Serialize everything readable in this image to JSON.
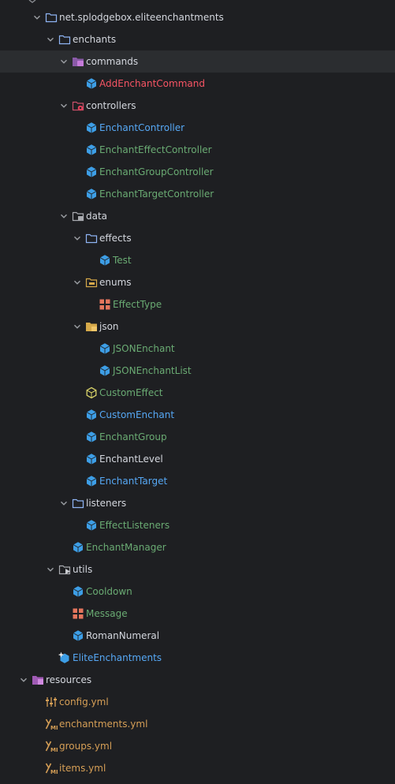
{
  "tree": [
    {
      "label": "net.splodgebox.eliteenchantments",
      "icon": "package-folder-icon",
      "color": "default",
      "depth": 1,
      "expand": "open"
    },
    {
      "label": "enchants",
      "icon": "package-folder-icon",
      "color": "default",
      "depth": 2,
      "expand": "open"
    },
    {
      "label": "commands",
      "icon": "commands-folder-icon",
      "color": "default",
      "depth": 3,
      "expand": "open",
      "selected": true
    },
    {
      "label": "AddEnchantCommand",
      "icon": "class-icon",
      "color": "red",
      "depth": 4,
      "expand": "none"
    },
    {
      "label": "controllers",
      "icon": "controllers-folder-icon",
      "color": "default",
      "depth": 3,
      "expand": "open"
    },
    {
      "label": "EnchantController",
      "icon": "class-icon",
      "color": "blue",
      "depth": 4,
      "expand": "none"
    },
    {
      "label": "EnchantEffectController",
      "icon": "class-icon",
      "color": "green",
      "depth": 4,
      "expand": "none"
    },
    {
      "label": "EnchantGroupController",
      "icon": "class-icon",
      "color": "green",
      "depth": 4,
      "expand": "none"
    },
    {
      "label": "EnchantTargetController",
      "icon": "class-icon",
      "color": "green",
      "depth": 4,
      "expand": "none"
    },
    {
      "label": "data",
      "icon": "data-folder-icon",
      "color": "default",
      "depth": 3,
      "expand": "open"
    },
    {
      "label": "effects",
      "icon": "package-folder-icon",
      "color": "default",
      "depth": 4,
      "expand": "open"
    },
    {
      "label": "Test",
      "icon": "class-icon",
      "color": "green",
      "depth": 5,
      "expand": "none"
    },
    {
      "label": "enums",
      "icon": "enums-folder-icon",
      "color": "default",
      "depth": 4,
      "expand": "open"
    },
    {
      "label": "EffectType",
      "icon": "enum-icon",
      "color": "green",
      "depth": 5,
      "expand": "none"
    },
    {
      "label": "json",
      "icon": "json-folder-icon",
      "color": "default",
      "depth": 4,
      "expand": "open"
    },
    {
      "label": "JSONEnchant",
      "icon": "class-icon",
      "color": "green",
      "depth": 5,
      "expand": "none"
    },
    {
      "label": "JSONEnchantList",
      "icon": "class-icon",
      "color": "green",
      "depth": 5,
      "expand": "none"
    },
    {
      "label": "CustomEffect",
      "icon": "interface-icon",
      "color": "green",
      "depth": 4,
      "expand": "none"
    },
    {
      "label": "CustomEnchant",
      "icon": "class-icon",
      "color": "blue",
      "depth": 4,
      "expand": "none"
    },
    {
      "label": "EnchantGroup",
      "icon": "class-icon",
      "color": "green",
      "depth": 4,
      "expand": "none"
    },
    {
      "label": "EnchantLevel",
      "icon": "class-icon",
      "color": "default",
      "depth": 4,
      "expand": "none"
    },
    {
      "label": "EnchantTarget",
      "icon": "class-icon",
      "color": "blue",
      "depth": 4,
      "expand": "none"
    },
    {
      "label": "listeners",
      "icon": "package-folder-icon",
      "color": "default",
      "depth": 3,
      "expand": "open"
    },
    {
      "label": "EffectListeners",
      "icon": "class-icon",
      "color": "green",
      "depth": 4,
      "expand": "none"
    },
    {
      "label": "EnchantManager",
      "icon": "class-icon",
      "color": "green",
      "depth": 3,
      "expand": "none"
    },
    {
      "label": "utils",
      "icon": "utils-folder-icon",
      "color": "default",
      "depth": 2,
      "expand": "open"
    },
    {
      "label": "Cooldown",
      "icon": "class-icon",
      "color": "green",
      "depth": 3,
      "expand": "none"
    },
    {
      "label": "Message",
      "icon": "enum-icon",
      "color": "green",
      "depth": 3,
      "expand": "none"
    },
    {
      "label": "RomanNumeral",
      "icon": "class-icon",
      "color": "default",
      "depth": 3,
      "expand": "none"
    },
    {
      "label": "EliteEnchantments",
      "icon": "main-class-icon",
      "color": "blue",
      "depth": 2,
      "expand": "none"
    },
    {
      "label": "resources",
      "icon": "resources-folder-icon",
      "color": "default",
      "depth": 0,
      "expand": "open"
    },
    {
      "label": "config.yml",
      "icon": "config-icon",
      "color": "orange",
      "depth": 1,
      "expand": "none"
    },
    {
      "label": "enchantments.yml",
      "icon": "yaml-icon",
      "color": "orange",
      "depth": 1,
      "expand": "none"
    },
    {
      "label": "groups.yml",
      "icon": "yaml-icon",
      "color": "orange",
      "depth": 1,
      "expand": "none"
    },
    {
      "label": "items.yml",
      "icon": "yaml-icon",
      "color": "orange",
      "depth": 1,
      "expand": "none"
    }
  ],
  "colors": {
    "background": "#1e1f22",
    "selected_row": "#2b2d30",
    "text_default": "#d4d7de",
    "text_green": "#6aab73",
    "text_blue": "#56a8f5",
    "text_red": "#f75464",
    "text_orange": "#d69f56",
    "folder_blue": "#8fb4f4",
    "class_blue": "#3d9ee6",
    "enum_orange": "#e5765d",
    "yaml_orange": "#d69f56",
    "resources_purple": "#a05bb5"
  }
}
